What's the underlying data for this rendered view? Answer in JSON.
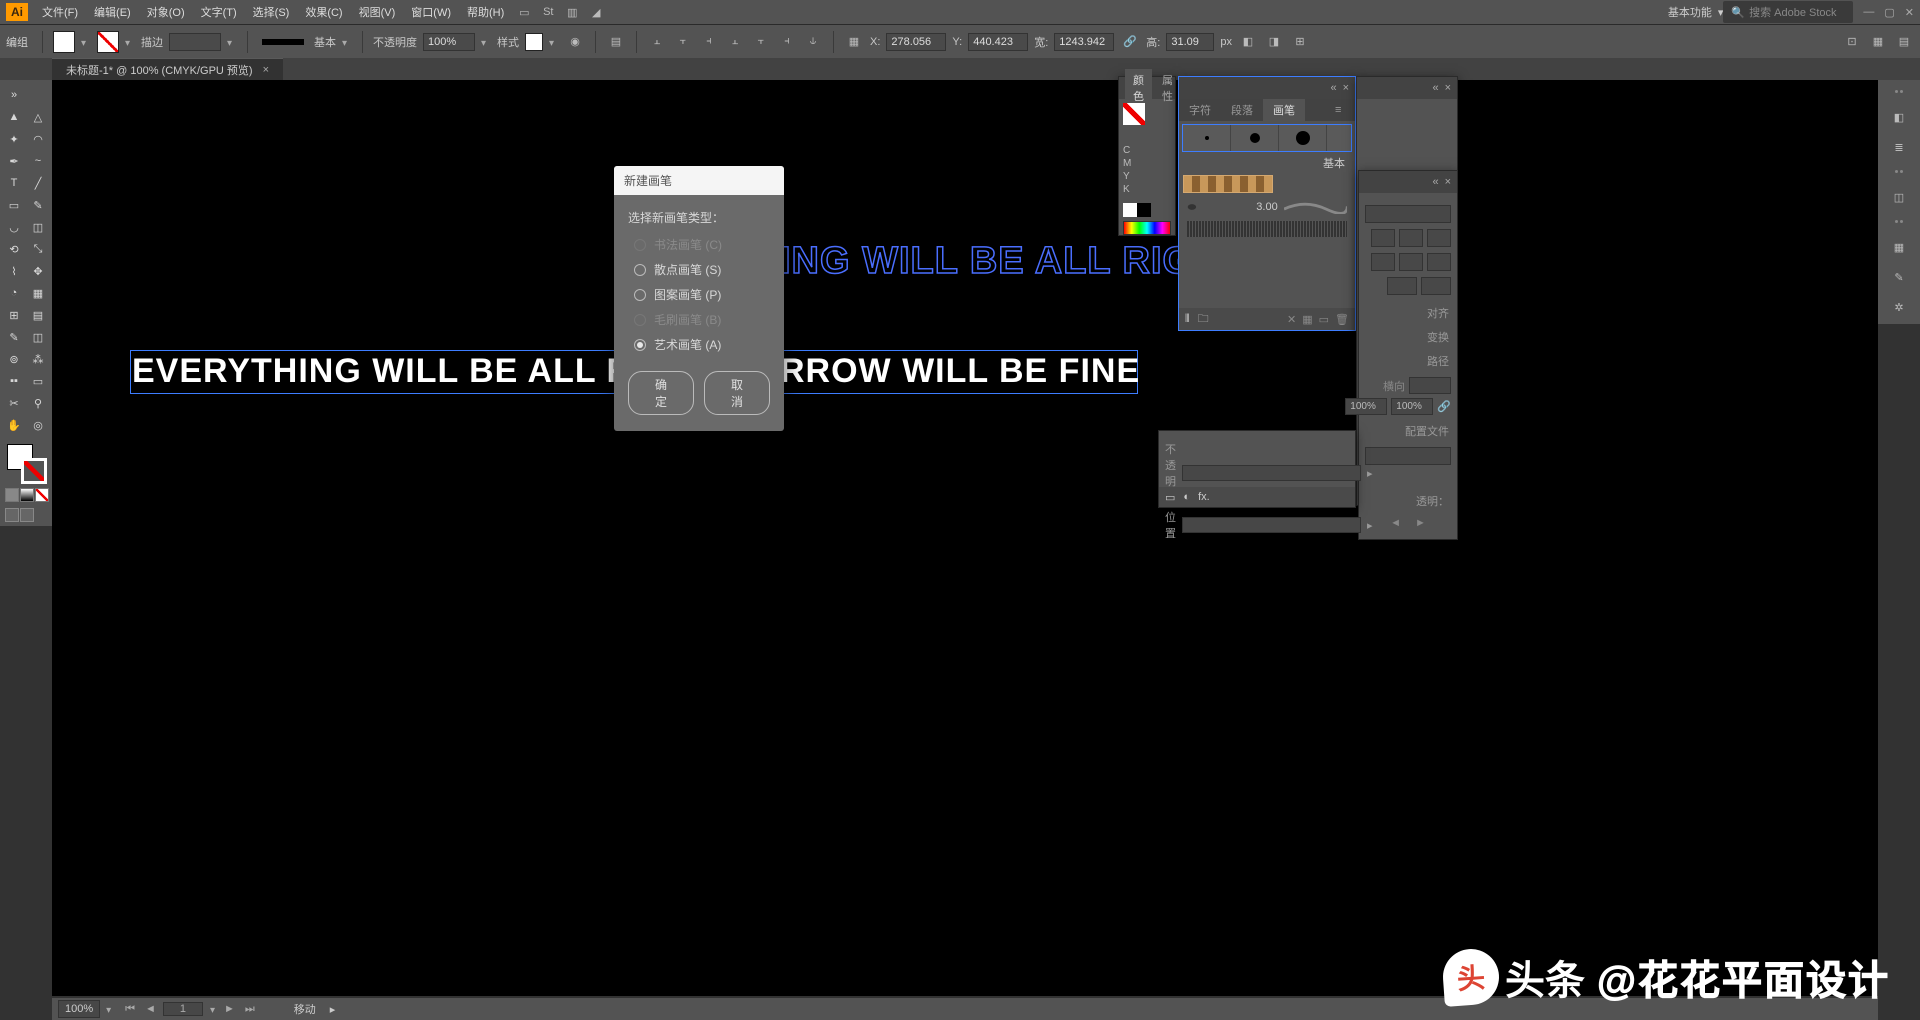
{
  "menubar": {
    "logo": "Ai",
    "items": [
      "文件(F)",
      "编辑(E)",
      "对象(O)",
      "文字(T)",
      "选择(S)",
      "效果(C)",
      "视图(V)",
      "窗口(W)",
      "帮助(H)"
    ],
    "workspace": "基本功能",
    "search_placeholder": "搜索 Adobe Stock"
  },
  "optbar": {
    "label": "编组",
    "stroke_label": "描边",
    "stroke_style": "基本",
    "opacity_label": "不透明度",
    "opacity_value": "100%",
    "style_label": "样式",
    "x_label": "X:",
    "x_value": "278.056",
    "y_label": "Y:",
    "y_value": "440.423",
    "w_label": "宽:",
    "w_value": "1243.942",
    "h_label": "高:",
    "h_value": "31.09",
    "unit": "px"
  },
  "tab": {
    "title": "未标题-1* @ 100% (CMYK/GPU 预览)"
  },
  "canvas": {
    "blue_text": "ING WILL BE ALL RIGH",
    "white_text_left": "EVERYTHING WILL BE ALL RIG",
    "white_text_right": "RROW WILL BE FINE"
  },
  "color_panel": {
    "tab1": "颜色",
    "tab2": "属性",
    "sliders": [
      "C",
      "M",
      "Y",
      "K"
    ]
  },
  "brush_panel": {
    "tabs": [
      "字符",
      "段落",
      "画笔"
    ],
    "basic_label": "基本",
    "cali_value": "3.00"
  },
  "trans_panel": {
    "tabs": [
      "对齐",
      "变换",
      "路径"
    ],
    "opacity_label": "横向",
    "w100": "100%",
    "h100": "100%",
    "profile_label": "配置文件",
    "trans_label": "透明："
  },
  "layer_panel": {
    "l1": "不透明度",
    "l2": "位置"
  },
  "dialog": {
    "title": "新建画笔",
    "prompt": "选择新画笔类型：",
    "opts": [
      {
        "label": "书法画笔 (C)",
        "state": "disabled"
      },
      {
        "label": "散点画笔 (S)",
        "state": "off"
      },
      {
        "label": "图案画笔 (P)",
        "state": "off"
      },
      {
        "label": "毛刷画笔 (B)",
        "state": "disabled"
      },
      {
        "label": "艺术画笔 (A)",
        "state": "on"
      }
    ],
    "ok": "确定",
    "cancel": "取消"
  },
  "status": {
    "zoom": "100%",
    "page": "1",
    "tool": "移动"
  },
  "watermark": {
    "brand": "头条",
    "handle": "@花花平面设计"
  }
}
